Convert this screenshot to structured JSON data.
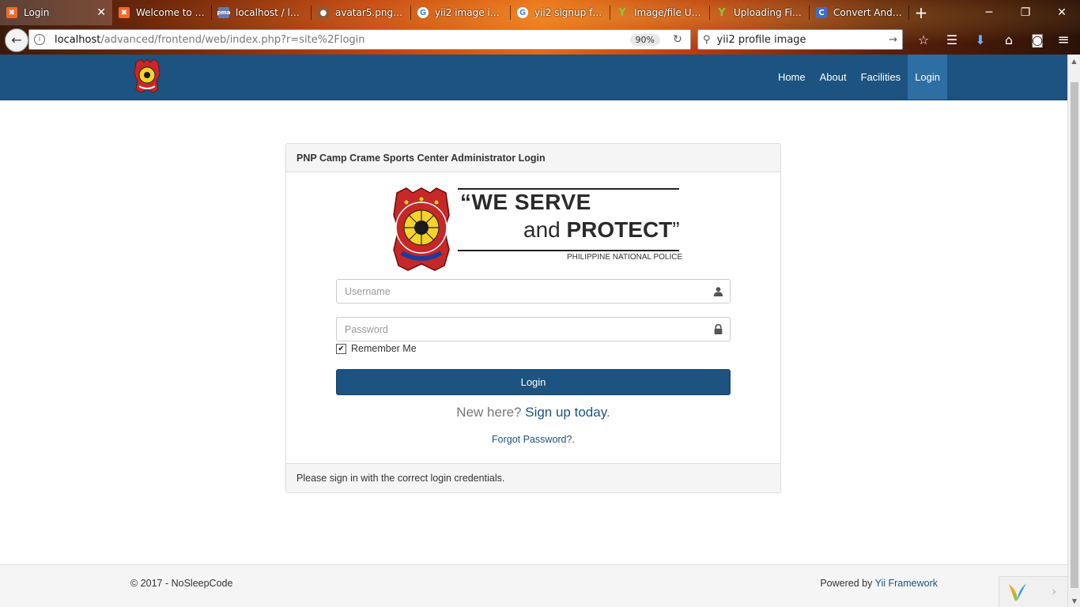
{
  "browser": {
    "tabs": [
      {
        "label": "Login",
        "active": true,
        "favicon": "xampp-icon",
        "color": "#f16a2d"
      },
      {
        "label": "Welcome to P...",
        "active": false,
        "favicon": "xampp-icon",
        "color": "#f16a2d"
      },
      {
        "label": "localhost / loc...",
        "active": false,
        "favicon": "phpmyadmin-icon",
        "color": "#6c78af"
      },
      {
        "label": "avatar5.png (P...",
        "active": false,
        "favicon": "image-icon",
        "color": "#8a5a3c"
      },
      {
        "label": "yii2 image in s...",
        "active": false,
        "favicon": "google-icon",
        "color": "#ffffff"
      },
      {
        "label": "yii2 signup for...",
        "active": false,
        "favicon": "google-icon",
        "color": "#ffffff"
      },
      {
        "label": "Image/file Upl...",
        "active": false,
        "favicon": "yii-icon",
        "color": "#8cc63f"
      },
      {
        "label": "Uploading File...",
        "active": false,
        "favicon": "yii-icon",
        "color": "#8cc63f"
      },
      {
        "label": "Convert And R...",
        "active": false,
        "favicon": "convert-icon",
        "color": "#3b6ec7"
      }
    ],
    "url_host": "localhost",
    "url_path": "/advanced/frontend/web/index.php?r=site%2Flogin",
    "zoom": "90%",
    "search_value": "yii2 profile image"
  },
  "site": {
    "nav": [
      {
        "label": "Home",
        "active": false
      },
      {
        "label": "About",
        "active": false
      },
      {
        "label": "Facilities",
        "active": false
      },
      {
        "label": "Login",
        "active": true
      }
    ],
    "brand_color": "#1c5380"
  },
  "panel": {
    "heading": "PNP Camp Crame Sports Center Administrator Login",
    "slogan_line1": "“WE SERVE",
    "slogan_and": "and ",
    "slogan_protect": "PROTECT",
    "slogan_close": "”",
    "slogan_org": "PHILIPPINE NATIONAL POLICE",
    "seal_text_top": "PHILIPPINE NATIONAL POLICE",
    "seal_text_bottom": "SERVICE HONOR JUSTICE",
    "username_placeholder": "Username",
    "password_placeholder": "Password",
    "remember_label": "Remember Me",
    "remember_checked": true,
    "login_button": "Login",
    "signup_prefix": "New here? ",
    "signup_link": "Sign up today",
    "signup_dot": ".",
    "forgot_link": "Forgot Password?.",
    "footer": "Please sign in with the correct login credentials."
  },
  "footer": {
    "copyright": "© 2017 - NoSleepCode",
    "powered_prefix": "Powered by ",
    "powered_link": "Yii Framework"
  }
}
